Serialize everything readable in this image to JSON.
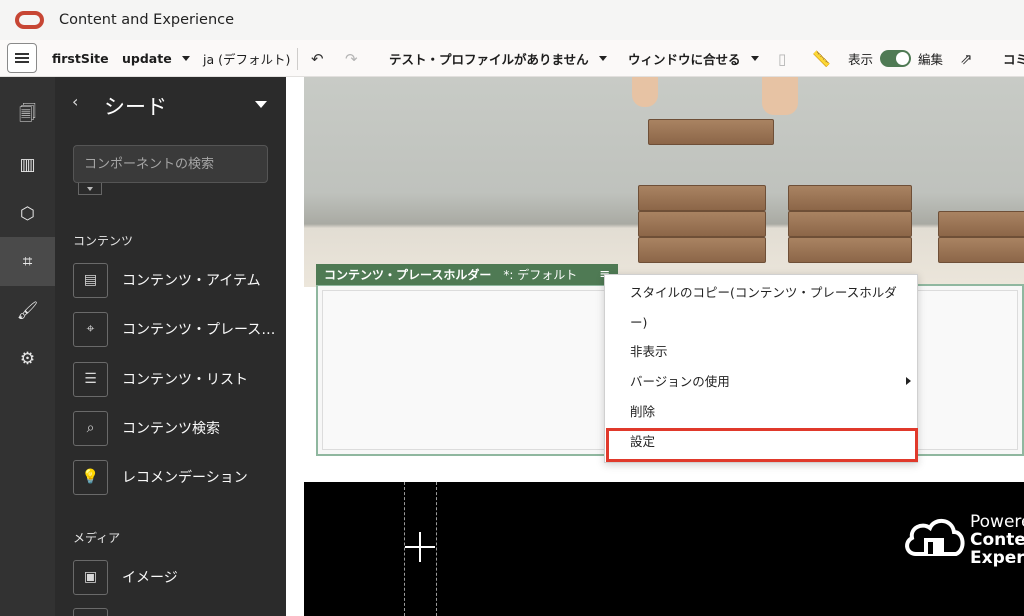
{
  "app": {
    "title": "Content and Experience"
  },
  "toolbar": {
    "site_name": "firstSite",
    "update_label": "update",
    "language_label": "ja (デフォルト)",
    "test_profile_label": "テスト・プロファイルがありません",
    "fit_window_label": "ウィンドウに合せる",
    "view_label": "表示",
    "edit_label": "編集",
    "overflow_label": "コミ"
  },
  "panel": {
    "back_glyph": "‹",
    "title": "シード",
    "search_placeholder": "コンポーネントの検索",
    "sections": [
      {
        "label": "コンテンツ"
      },
      {
        "label": "メディア"
      }
    ],
    "content_items": [
      {
        "label": "コンテンツ・アイテム",
        "icon": "document-icon"
      },
      {
        "label": "コンテンツ・プレースホルダー",
        "icon": "document-pin-icon"
      },
      {
        "label": "コンテンツ・リスト",
        "icon": "document-list-icon"
      },
      {
        "label": "コンテンツ検索",
        "icon": "document-search-icon"
      },
      {
        "label": "レコメンデーション",
        "icon": "lightbulb-icon"
      }
    ],
    "media_items": [
      {
        "label": "イメージ",
        "icon": "image-icon"
      }
    ]
  },
  "rail": {
    "items": [
      {
        "name": "pages-icon"
      },
      {
        "name": "layout-icon"
      },
      {
        "name": "components-icon"
      },
      {
        "name": "crop-icon"
      },
      {
        "name": "theme-icon"
      },
      {
        "name": "settings-icon"
      }
    ],
    "active_index": 3
  },
  "canvas": {
    "placeholder_tab": {
      "title": "コンテンツ・プレースホルダー",
      "suffix": "*: デフォルト"
    },
    "context_menu": {
      "items": [
        {
          "label": "スタイルのコピー(コンテンツ・プレースホルダ"
        },
        {
          "label": "ー)"
        },
        {
          "label": "非表示"
        },
        {
          "label": "バージョンの使用",
          "has_submenu": true
        },
        {
          "label": "削除"
        },
        {
          "label": "設定",
          "highlighted": true
        }
      ]
    },
    "footer_brand": {
      "line1": "Powere",
      "line2": "Conter",
      "line3": "Experi"
    }
  },
  "colors": {
    "accent_green": "#4f7a54",
    "highlight_red": "#e0392b",
    "oracle_red": "#c74634",
    "panel_dark": "#2b2b2b"
  }
}
